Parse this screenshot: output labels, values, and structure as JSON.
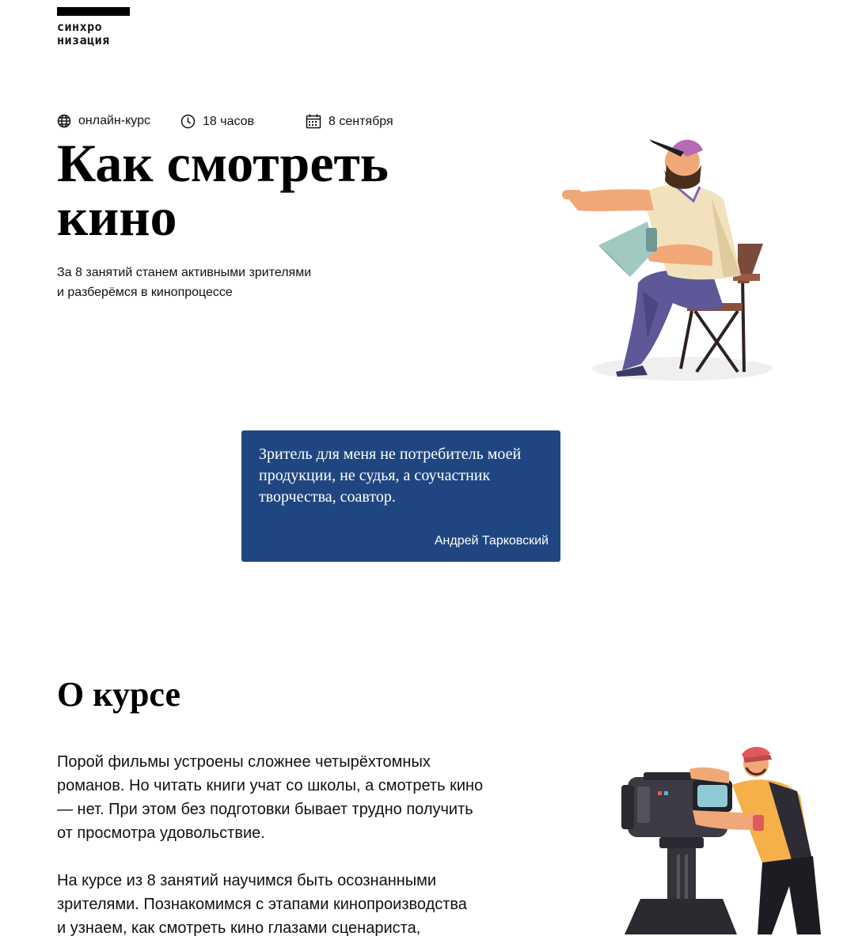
{
  "logo": {
    "line1": "синхро",
    "line2": "низация"
  },
  "meta": {
    "format": {
      "icon": "globe-icon",
      "label": "онлайн-курс"
    },
    "duration": {
      "icon": "clock-icon",
      "label": "18 часов"
    },
    "start": {
      "icon": "calendar-icon",
      "label": "8 сентября"
    }
  },
  "hero": {
    "title_line1": "Как смотреть",
    "title_line2": "кино",
    "subtitle_line1": "За 8 занятий станем активными зрителями",
    "subtitle_line2": "и разберёмся в кинопроцессе"
  },
  "quote": {
    "line1": "Зритель для меня не потребитель моей",
    "line2": "продукции, не судья, а соучастник",
    "line3": "творчества, соавтор.",
    "author": "Андрей Тарковский"
  },
  "about": {
    "title": "О курсе",
    "p1": [
      "Порой фильмы устроены сложнее четырёхтомных",
      "романов. Но читать книги учат со школы, а смотреть кино",
      "— нет. При этом без подготовки бывает трудно получить",
      "от просмотра удовольствие."
    ],
    "p2": [
      "На курсе из 8 занятий научимся быть осознанными",
      "зрителями. Познакомимся с этапами кинопроизводства",
      "и узнаем, как смотреть кино глазами сценариста,"
    ]
  },
  "colors": {
    "quote_bg": "#1f4680",
    "text": "#111111",
    "logo_bar": "#000000"
  }
}
